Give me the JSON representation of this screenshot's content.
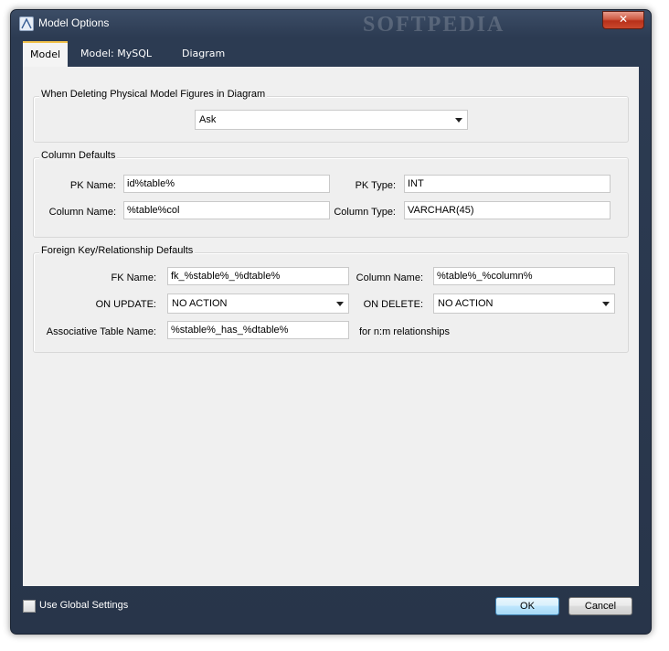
{
  "window": {
    "title": "Model Options",
    "watermark": "SOFTPEDIA",
    "close_glyph": "✕"
  },
  "tabs": [
    {
      "label": "Model",
      "active": true
    },
    {
      "label": "Model: MySQL",
      "active": false
    },
    {
      "label": "Diagram",
      "active": false
    }
  ],
  "delete_group": {
    "title": "When Deleting Physical Model Figures in Diagram",
    "selected": "Ask"
  },
  "column_defaults": {
    "title": "Column Defaults",
    "pk_name_label": "PK Name:",
    "pk_name_value": "id%table%",
    "pk_type_label": "PK Type:",
    "pk_type_value": "INT",
    "column_name_label": "Column Name:",
    "column_name_value": "%table%col",
    "column_type_label": "Column Type:",
    "column_type_value": "VARCHAR(45)"
  },
  "fk_defaults": {
    "title": "Foreign Key/Relationship Defaults",
    "fk_name_label": "FK Name:",
    "fk_name_value": "fk_%stable%_%dtable%",
    "column_name_label": "Column Name:",
    "column_name_value": "%table%_%column%",
    "on_update_label": "ON UPDATE:",
    "on_update_value": "NO ACTION",
    "on_delete_label": "ON DELETE:",
    "on_delete_value": "NO ACTION",
    "assoc_label": "Associative Table Name:",
    "assoc_value": "%stable%_has_%dtable%",
    "assoc_note": "for n:m relationships"
  },
  "footer": {
    "global_settings_label": "Use Global Settings",
    "global_settings_checked": false,
    "ok_label": "OK",
    "cancel_label": "Cancel"
  }
}
